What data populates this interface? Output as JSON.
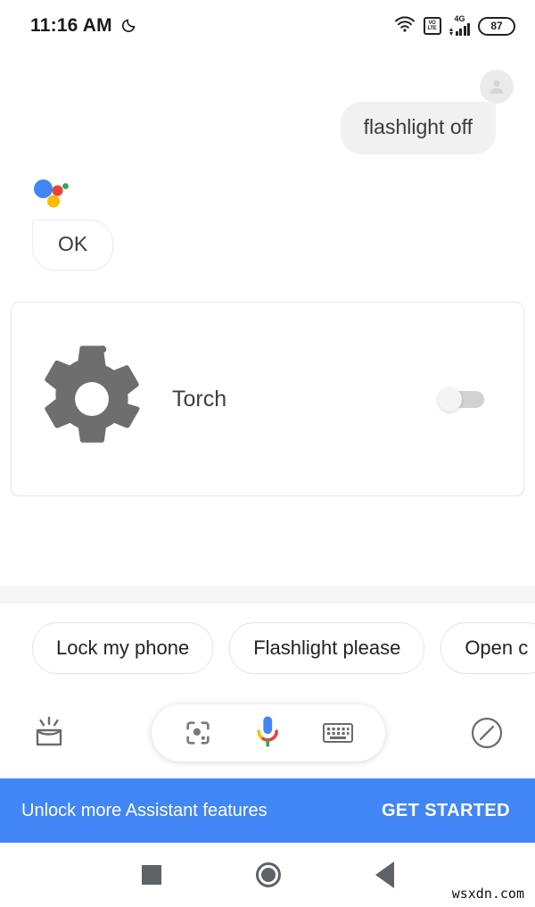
{
  "status_bar": {
    "time": "11:16 AM",
    "dnd_icon": "moon-icon",
    "wifi_icon": "wifi-icon",
    "volte_line1": "VO",
    "volte_line2": "LTE",
    "network": "4G",
    "battery_level": "87"
  },
  "conversation": {
    "user": {
      "avatar_icon": "user-avatar-icon",
      "message": "flashlight off"
    },
    "assistant": {
      "logo_icon": "google-assistant-logo",
      "message": "OK"
    }
  },
  "card": {
    "icon": "gear-icon",
    "title": "Torch",
    "toggle_state": "off"
  },
  "suggestions": {
    "chips": [
      {
        "label": "Lock my phone"
      },
      {
        "label": "Flashlight please"
      },
      {
        "label": "Open c"
      }
    ]
  },
  "bottom_bar": {
    "snapshot_icon": "snapshot-icon",
    "lens_icon": "google-lens-icon",
    "mic_icon": "google-mic-icon",
    "keyboard_icon": "keyboard-icon",
    "explore_icon": "compass-explore-icon"
  },
  "banner": {
    "text": "Unlock more Assistant features",
    "cta": "GET STARTED",
    "color": "#4285F4"
  },
  "nav_bar": {
    "recents_icon": "recents-square-icon",
    "home_icon": "home-circle-icon",
    "back_icon": "back-triangle-icon"
  },
  "watermark": "wsxdn.com",
  "colors": {
    "google_blue": "#4285F4",
    "google_red": "#EA4335",
    "google_yellow": "#FBBC05",
    "google_green": "#34A853",
    "gear_gray": "#6e6e6e",
    "bubble_gray": "#f1f1f1"
  }
}
